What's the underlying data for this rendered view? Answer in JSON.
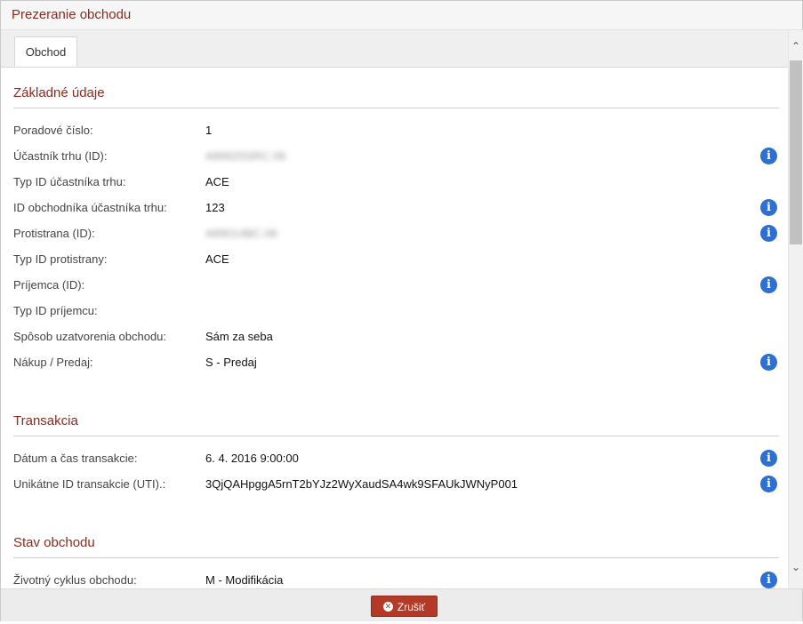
{
  "dialog": {
    "title": "Prezeranie obchodu"
  },
  "tabs": [
    {
      "label": "Obchod"
    }
  ],
  "sections": {
    "basic": {
      "title": "Základné údaje",
      "rows": [
        {
          "label": "Poradové číslo:",
          "value": "1",
          "info": false
        },
        {
          "label": "Účastník trhu (ID):",
          "value": "A89925SRC.06",
          "info": true,
          "redacted": true
        },
        {
          "label": "Typ ID účastníka trhu:",
          "value": "ACE",
          "info": false
        },
        {
          "label": "ID obchodníka účastníka trhu:",
          "value": "123",
          "info": true
        },
        {
          "label": "Protistrana (ID):",
          "value": "A89014BC.06",
          "info": true,
          "redacted": true
        },
        {
          "label": "Typ ID protistrany:",
          "value": "ACE",
          "info": false
        },
        {
          "label": "Príjemca (ID):",
          "value": "",
          "info": true
        },
        {
          "label": "Typ ID príjemcu:",
          "value": "",
          "info": false
        },
        {
          "label": "Spôsob uzatvorenia obchodu:",
          "value": "Sám za seba",
          "info": false
        },
        {
          "label": "Nákup / Predaj:",
          "value": "S - Predaj",
          "info": true
        }
      ]
    },
    "transaction": {
      "title": "Transakcia",
      "rows": [
        {
          "label": "Dátum a čas transakcie:",
          "value": "6. 4. 2016 9:00:00",
          "info": true
        },
        {
          "label": "Unikátne ID transakcie (UTI).:",
          "value": "3QjQAHpggA5rnT2bYJz2WyXaudSA4wk9SFAUkJWNyP001",
          "info": true
        }
      ]
    },
    "state": {
      "title": "Stav obchodu",
      "rows": [
        {
          "label": "Životný cyklus obchodu:",
          "value": "M - Modifikácia",
          "info": true
        }
      ]
    }
  },
  "icons": {
    "info": "i",
    "scroll_up": "⌃",
    "scroll_down": "⌄",
    "cancel": "✕"
  },
  "footer": {
    "cancel_label": "Zrušiť"
  },
  "colors": {
    "accent": "#8b2a1e",
    "button": "#b23a26",
    "info_icon": "#2d6fd2"
  }
}
